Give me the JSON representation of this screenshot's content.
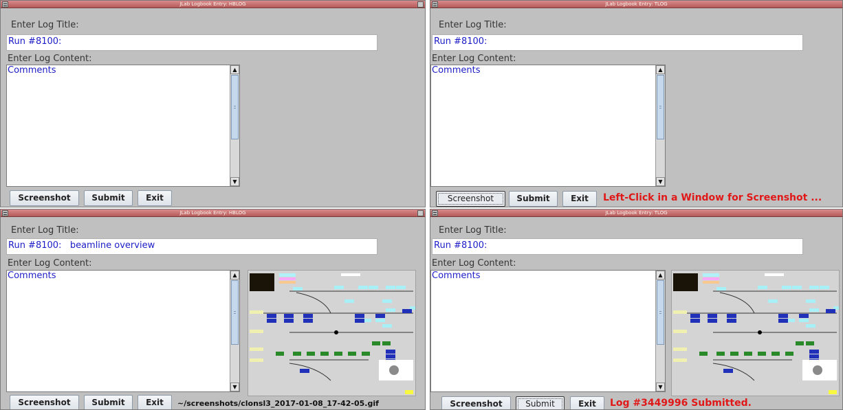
{
  "panes": [
    {
      "window_title": "JLab Logbook Entry:  HBLOG",
      "title_label": "Enter Log Title:",
      "title_value": "Run #8100:",
      "content_label": "Enter Log Content:",
      "content_value": "Comments",
      "buttons": {
        "screenshot": "Screenshot",
        "submit": "Submit",
        "exit": "Exit"
      },
      "status": ""
    },
    {
      "window_title": "JLab Logbook Entry:  TLOG",
      "title_label": "Enter Log Title:",
      "title_value": "Run #8100:",
      "content_label": "Enter Log Content:",
      "content_value": "Comments",
      "buttons": {
        "screenshot": "Screenshot",
        "submit": "Submit",
        "exit": "Exit"
      },
      "status": "Left-Click in a Window for Screenshot ..."
    },
    {
      "window_title": "JLab Logbook Entry:  HBLOG",
      "title_label": "Enter Log Title:",
      "title_value": "Run #8100:   beamline overview",
      "content_label": "Enter Log Content:",
      "content_value": "Comments",
      "buttons": {
        "screenshot": "Screenshot",
        "submit": "Submit",
        "exit": "Exit"
      },
      "status": "~/screenshots/clonsl3_2017-01-08_17-42-05.gif",
      "has_thumbnail": true
    },
    {
      "window_title": "JLab Logbook Entry:  TLOG",
      "title_label": "Enter Log Title:",
      "title_value": "Run #8100:",
      "content_label": "Enter Log Content:",
      "content_value": "Comments",
      "buttons": {
        "screenshot": "Screenshot",
        "submit": "Submit",
        "exit": "Exit"
      },
      "status": "Log #3449996 Submitted.",
      "has_thumbnail": true
    }
  ],
  "colors": {
    "titlebar": "#c06a6a",
    "text_blue": "#1c1cc8",
    "status_red": "#e01818",
    "panel_bg": "#c0c0c0"
  },
  "icons": {
    "window_menu": "window-menu-icon",
    "maximize": "maximize-icon",
    "scroll_up": "arrow-up-icon",
    "scroll_down": "arrow-down-icon"
  }
}
